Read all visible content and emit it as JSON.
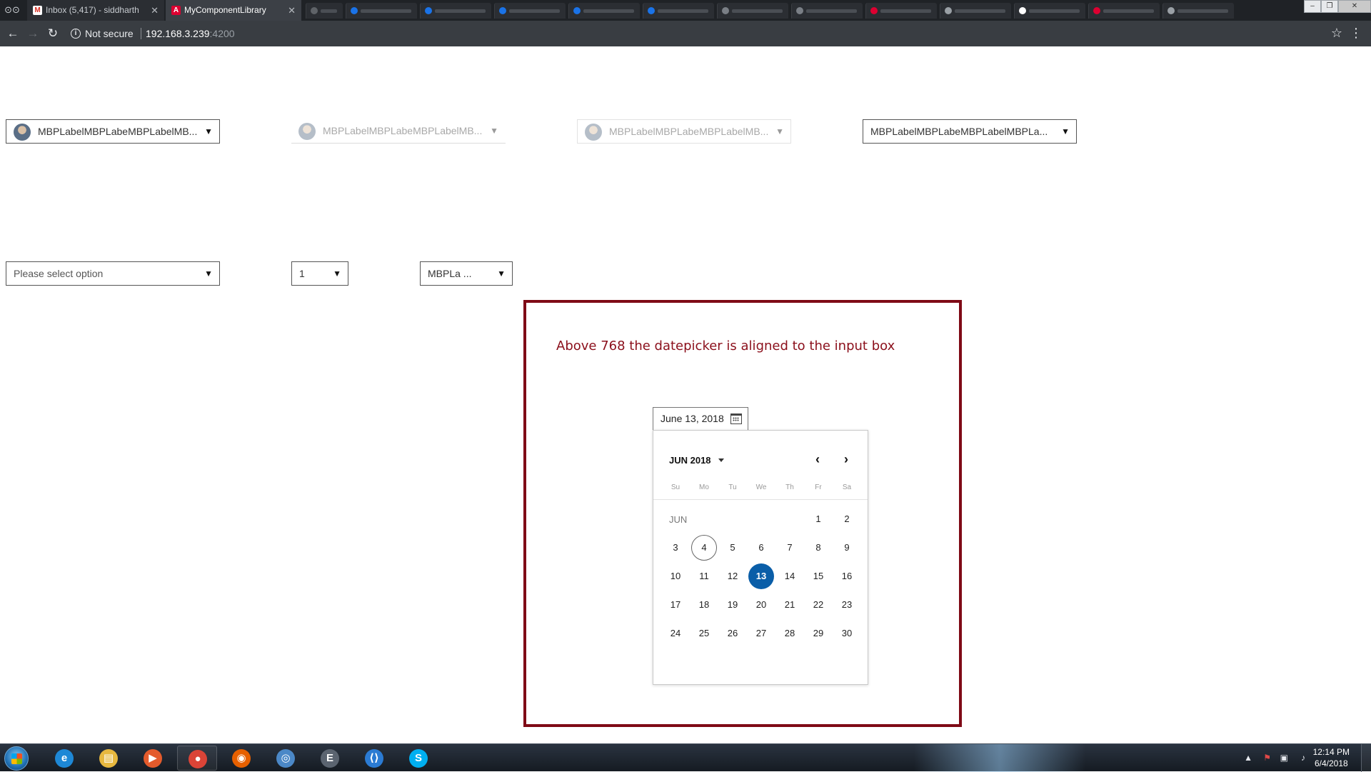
{
  "browser": {
    "tabs": [
      {
        "title": "Inbox (5,417) - siddharth",
        "favicon": "gmail-icon",
        "active": false
      },
      {
        "title": "MyComponentLibrary",
        "favicon": "angular-icon",
        "active": true
      }
    ],
    "address": {
      "security_label": "Not secure",
      "host": "192.168.3.239",
      "port": ":4200"
    }
  },
  "page": {
    "dropdowns_row1": [
      {
        "label": "MBPLabelMBPLabeMBPLabelMB...",
        "style": "with-avatar"
      },
      {
        "label": "MBPLabelMBPLabeMBPLabelMB...",
        "style": "underline-disabled"
      },
      {
        "label": "MBPLabelMBPLabeMBPLabelMB...",
        "style": "faded"
      },
      {
        "label": "MBPLabelMBPLabeMBPLabelMBPLa...",
        "style": "plain"
      }
    ],
    "dropdowns_row2": [
      {
        "label": "Please select option"
      },
      {
        "label": "1"
      },
      {
        "label": "MBPLa ..."
      }
    ],
    "caret_glyph": "▼",
    "demo": {
      "caption": "Above 768 the datepicker is aligned to the input box",
      "date_input_value": "June 13, 2018",
      "border_color": "#7f0a16"
    }
  },
  "datepicker": {
    "month_year": "JUN 2018",
    "month_label": "JUN",
    "prev_glyph": "‹",
    "next_glyph": "›",
    "weekdays": [
      "Su",
      "Mo",
      "Tu",
      "We",
      "Th",
      "Fr",
      "Sa"
    ],
    "first_weekday_index": 5,
    "days": [
      "1",
      "2",
      "3",
      "4",
      "5",
      "6",
      "7",
      "8",
      "9",
      "10",
      "11",
      "12",
      "13",
      "14",
      "15",
      "16",
      "17",
      "18",
      "19",
      "20",
      "21",
      "22",
      "23",
      "24",
      "25",
      "26",
      "27",
      "28",
      "29",
      "30"
    ],
    "today": "4",
    "selected": "13",
    "selected_color": "#0a5ea8"
  },
  "taskbar": {
    "pinned": [
      {
        "name": "internet-explorer-icon",
        "glyph": "e",
        "color": "#1e88d6"
      },
      {
        "name": "file-explorer-icon",
        "glyph": "▤",
        "color": "#e7b83f"
      },
      {
        "name": "media-player-icon",
        "glyph": "▶",
        "color": "#e45b2c"
      },
      {
        "name": "chrome-icon",
        "glyph": "●",
        "color": "#db4437"
      },
      {
        "name": "firefox-icon",
        "glyph": "◉",
        "color": "#e66000"
      },
      {
        "name": "network-icon",
        "glyph": "◎",
        "color": "#4b88c7"
      },
      {
        "name": "editor-icon",
        "glyph": "E",
        "color": "#5b6470"
      },
      {
        "name": "vscode-icon",
        "glyph": "⟨⟩",
        "color": "#2b7bd3"
      },
      {
        "name": "skype-icon",
        "glyph": "S",
        "color": "#00aff0"
      }
    ],
    "clock_time": "12:14 PM",
    "clock_date": "6/4/2018"
  }
}
